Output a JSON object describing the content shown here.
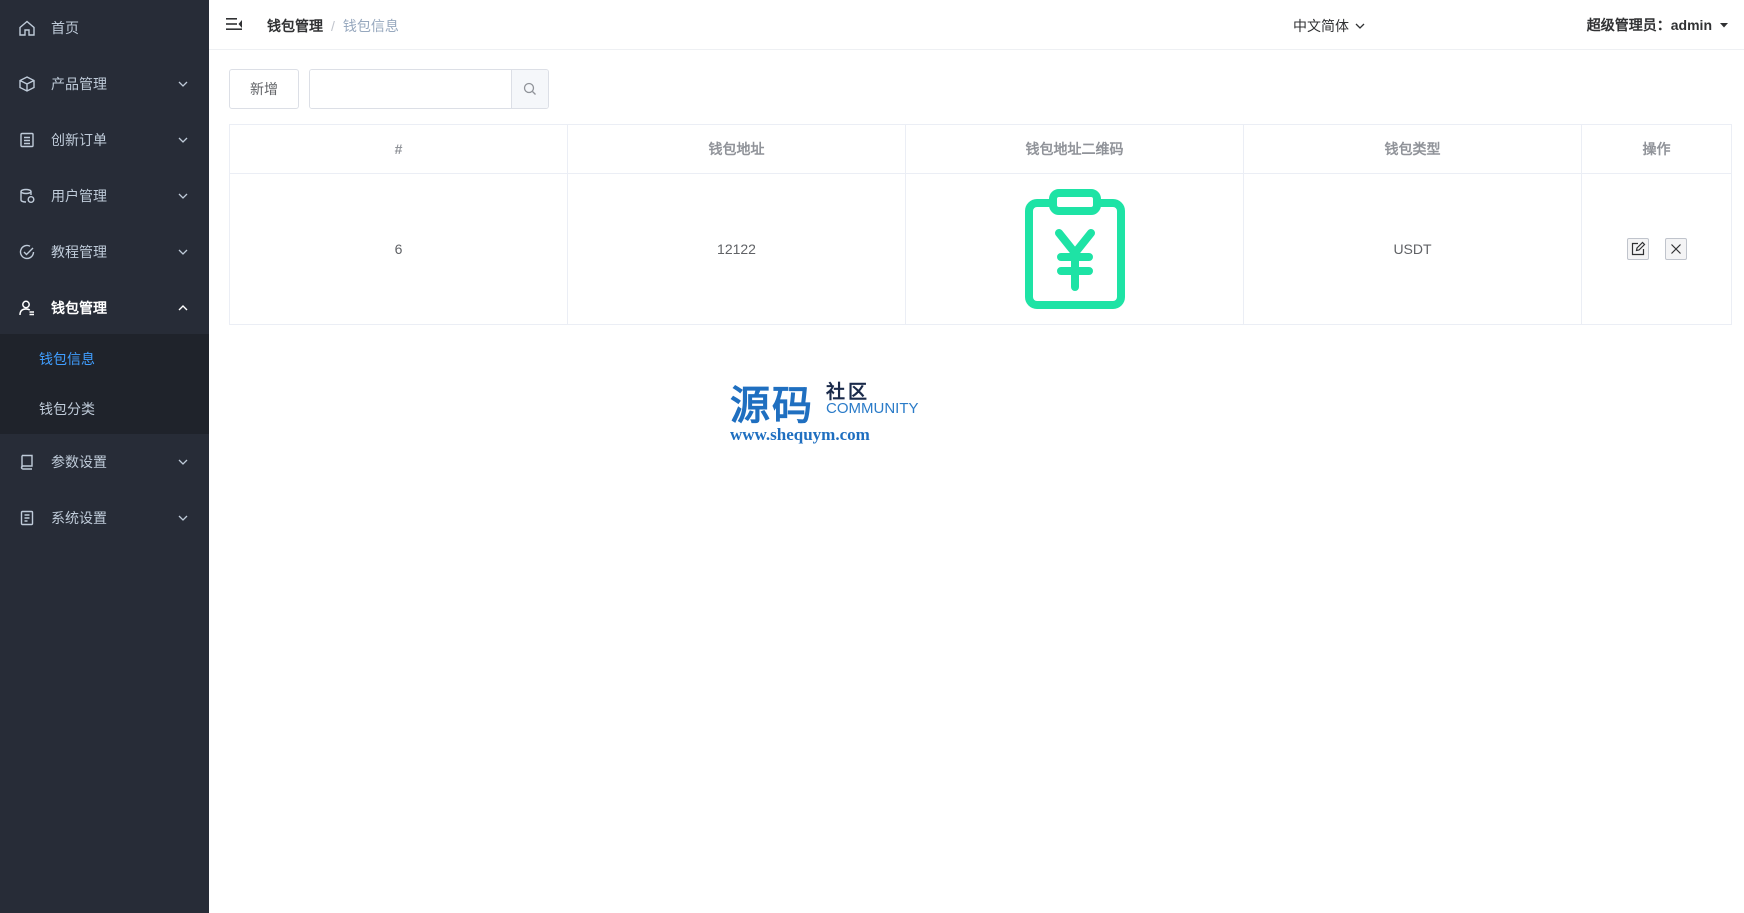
{
  "sidebar": {
    "items": [
      {
        "label": "首页",
        "icon": "home-icon",
        "has_children": false
      },
      {
        "label": "产品管理",
        "icon": "cube-icon",
        "has_children": true
      },
      {
        "label": "创新订单",
        "icon": "list-icon",
        "has_children": true
      },
      {
        "label": "用户管理",
        "icon": "users-icon",
        "has_children": true
      },
      {
        "label": "教程管理",
        "icon": "check-circle-icon",
        "has_children": true
      },
      {
        "label": "钱包管理",
        "icon": "user-wallet-icon",
        "has_children": true,
        "expanded": true
      },
      {
        "label": "参数设置",
        "icon": "book-icon",
        "has_children": true
      },
      {
        "label": "系统设置",
        "icon": "document-icon",
        "has_children": true
      }
    ],
    "submenu": [
      {
        "label": "钱包信息",
        "active": true
      },
      {
        "label": "钱包分类",
        "active": false
      }
    ],
    "colors": {
      "bg": "#272c37",
      "sub_bg": "#1f232b",
      "active": "#409eff"
    }
  },
  "header": {
    "breadcrumb": [
      "钱包管理",
      "钱包信息"
    ],
    "separator": "/",
    "language": "中文简体",
    "user": "超级管理员：admin"
  },
  "toolbar": {
    "add_label": "新增",
    "search_placeholder": ""
  },
  "table": {
    "columns": [
      "#",
      "钱包地址",
      "钱包地址二维码",
      "钱包类型",
      "操作"
    ],
    "rows": [
      {
        "id": "6",
        "address": "12122",
        "qr_icon": "clipboard-yen-icon",
        "type": "USDT"
      }
    ],
    "qr_color": "#1ee3a5"
  },
  "watermark": {
    "big": "源码",
    "small": "社区",
    "community": "COMMUNITY",
    "url": "www.shequym.com"
  }
}
